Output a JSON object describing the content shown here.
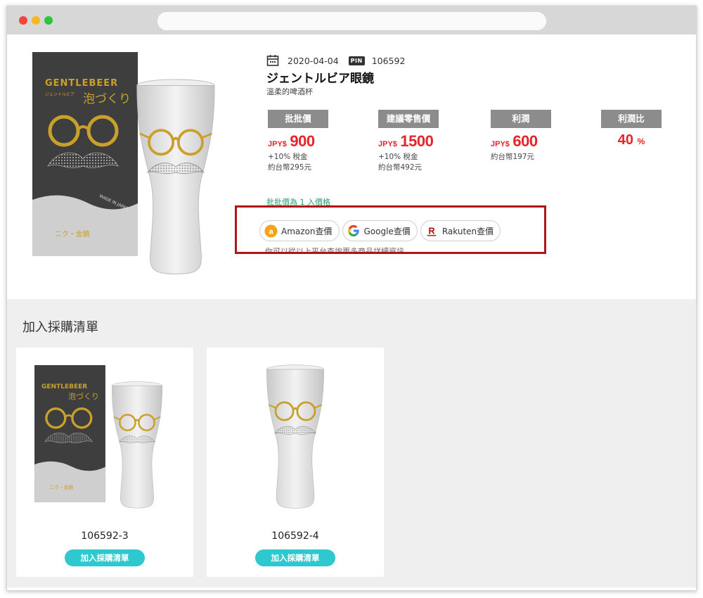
{
  "product": {
    "date": "2020-04-04",
    "pin_label": "PIN",
    "pin_code": "106592",
    "title": "ジェントルビア眼鏡",
    "subtitle": "溫柔的啤酒杯"
  },
  "prices": {
    "currency": "JPY$",
    "wholesale": {
      "label": "批批價",
      "value": "900",
      "note1": "+10% 稅金",
      "note2": "約台幣295元"
    },
    "retail": {
      "label": "建議零售價",
      "value": "1500",
      "note1": "+10% 稅金",
      "note2": "約台幣492元"
    },
    "profit": {
      "label": "利潤",
      "value": "600",
      "note1": "約台幣197元"
    },
    "ratio": {
      "label": "利潤比",
      "value": "40",
      "unit": "%"
    }
  },
  "min_note": "批批價為 1 入價格",
  "search": {
    "amazon": "Amazon查價",
    "google": "Google查價",
    "rakuten": "Rakuten查價",
    "hint": "你可以從以上平台查詢更多商品詳細資訊"
  },
  "cart": {
    "title": "加入採購清單",
    "items": [
      {
        "code": "106592-3",
        "button": "加入採購清單"
      },
      {
        "code": "106592-4",
        "button": "加入採購清單"
      }
    ]
  },
  "box_art": {
    "brand": "GENTLEBEER",
    "kana": "ジェントルビア",
    "foam": "泡づくり",
    "made": "MADE IN JAPAN"
  },
  "colors": {
    "accent": "#2fc8cf",
    "price_red": "#e8242a",
    "highlight": "#b0141b"
  }
}
